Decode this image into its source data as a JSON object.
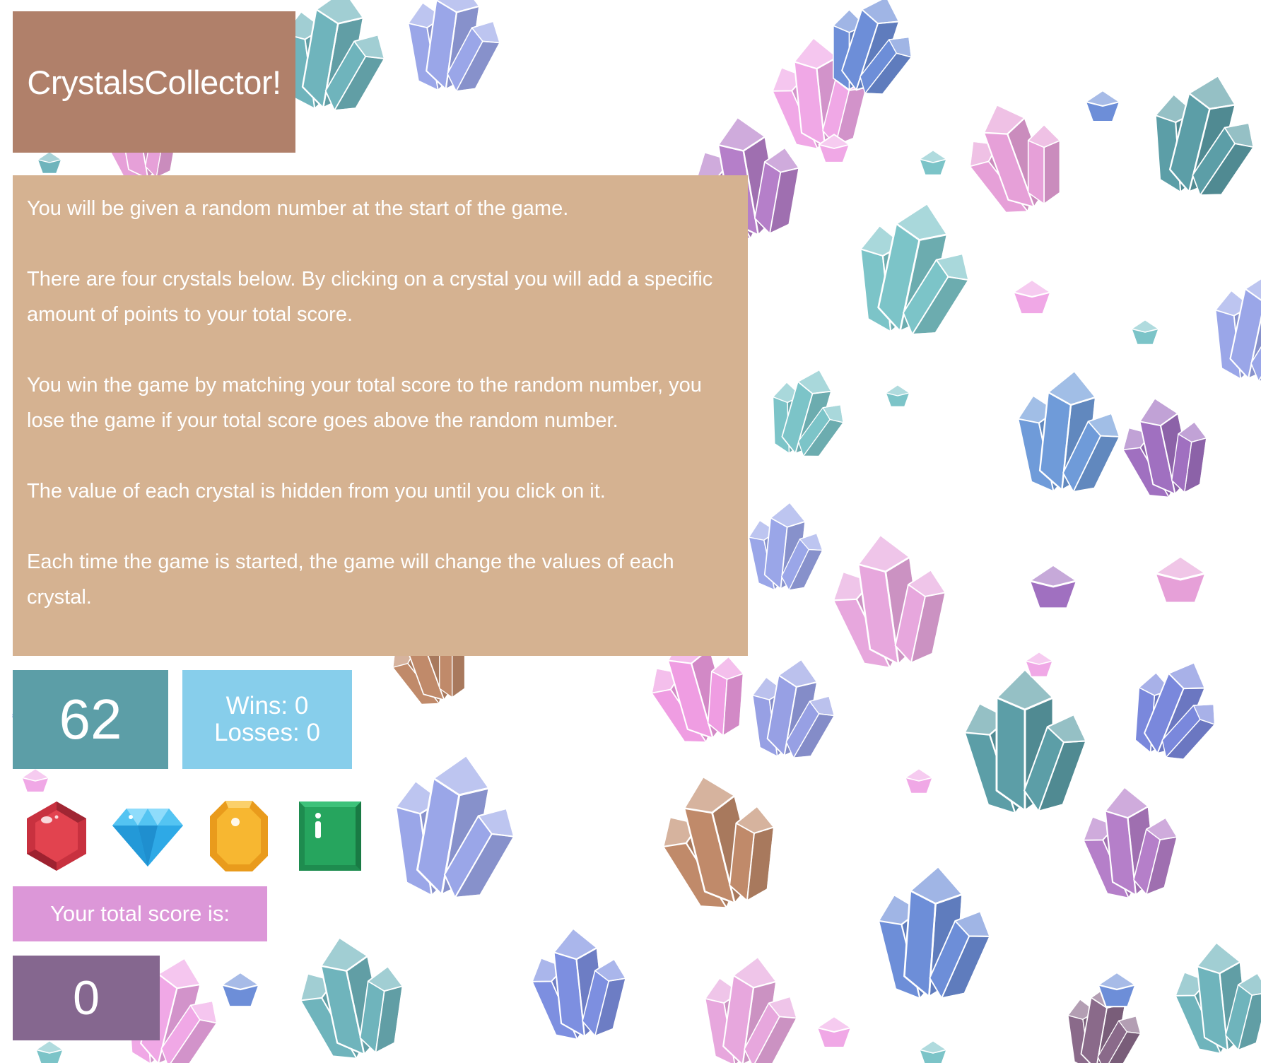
{
  "game": {
    "title": "CrystalsCollector!",
    "instructions": [
      "You will be given a random number at the start of the game.",
      "There are four crystals below. By clicking on a crystal you will add a specific amount of points to your total score.",
      "You win the game by matching your total score to the random number, you lose the game if your total score goes above the random number.",
      "The value of each crystal is hidden from you until you click on it.",
      "Each time the game is started, the game will change the values of each crystal."
    ],
    "target_number": "62",
    "wins_text": "Wins: 0",
    "losses_text": "Losses: 0",
    "score_label": "Your total score is:",
    "total_score": "0"
  },
  "crystals": [
    {
      "name": "ruby-crystal",
      "icon": "red-ruby-icon",
      "color": "#e0404e"
    },
    {
      "name": "diamond-crystal",
      "icon": "blue-diamond-icon",
      "color": "#2ea9e6"
    },
    {
      "name": "topaz-crystal",
      "icon": "yellow-topaz-icon",
      "color": "#f7b731"
    },
    {
      "name": "emerald-crystal",
      "icon": "green-emerald-icon",
      "color": "#26a55e"
    }
  ],
  "colors": {
    "title_bg": "#b0806a",
    "instructions_bg": "#d5b291",
    "target_bg": "#5c9ea7",
    "record_bg": "#87ceeb",
    "score_label_bg": "#dc97d8",
    "score_bg": "#85678f"
  }
}
